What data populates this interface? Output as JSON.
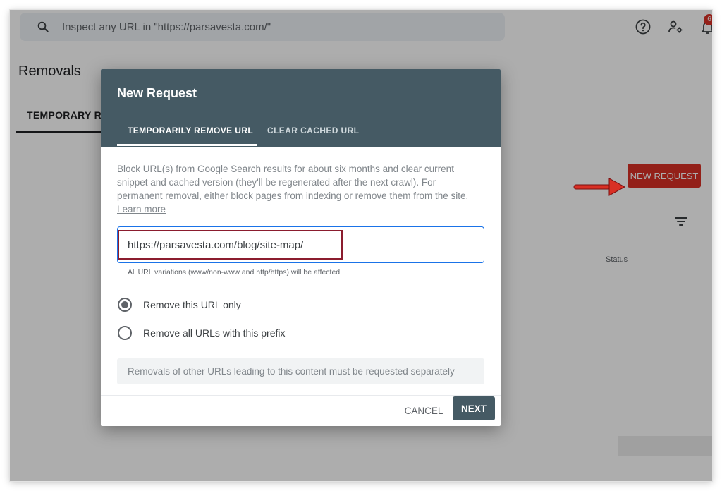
{
  "topbar": {
    "search_placeholder": "Inspect any URL in \"https://parsavesta.com/\"",
    "search_icon": "search-icon",
    "help_icon": "help-icon",
    "account_icon": "manage-users-icon",
    "bell_icon": "notifications-icon",
    "notification_count": "6"
  },
  "page": {
    "title": "Removals",
    "tab_partial": "TEMPORARY REM"
  },
  "background": {
    "new_request_label": "NEW REQUEST",
    "status_column": "Status",
    "filter_icon": "filter-icon",
    "arrow_color": "#d93025"
  },
  "dialog": {
    "title": "New Request",
    "tabs": [
      {
        "label": "TEMPORARILY REMOVE URL",
        "active": true
      },
      {
        "label": "CLEAR CACHED URL",
        "active": false
      }
    ],
    "description": "Block URL(s) from Google Search results for about six months and clear current snippet and cached version (they'll be regenerated after the next crawl). For permanent removal, either block pages from indexing or remove them from the site.",
    "learn_more": "Learn more",
    "url_value": "https://parsavesta.com/blog/site-map/",
    "url_hint": "All URL variations (www/non-www and http/https) will be affected",
    "options": [
      {
        "label": "Remove this URL only",
        "checked": true
      },
      {
        "label": "Remove all URLs with this prefix",
        "checked": false
      }
    ],
    "info": "Removals of other URLs leading to this content must be requested separately",
    "cancel_label": "CANCEL",
    "next_label": "NEXT"
  },
  "colors": {
    "header": "#455a64",
    "accent_red": "#d93025",
    "highlight_box": "#8b1c2e",
    "focus_blue": "#1a73e8"
  }
}
